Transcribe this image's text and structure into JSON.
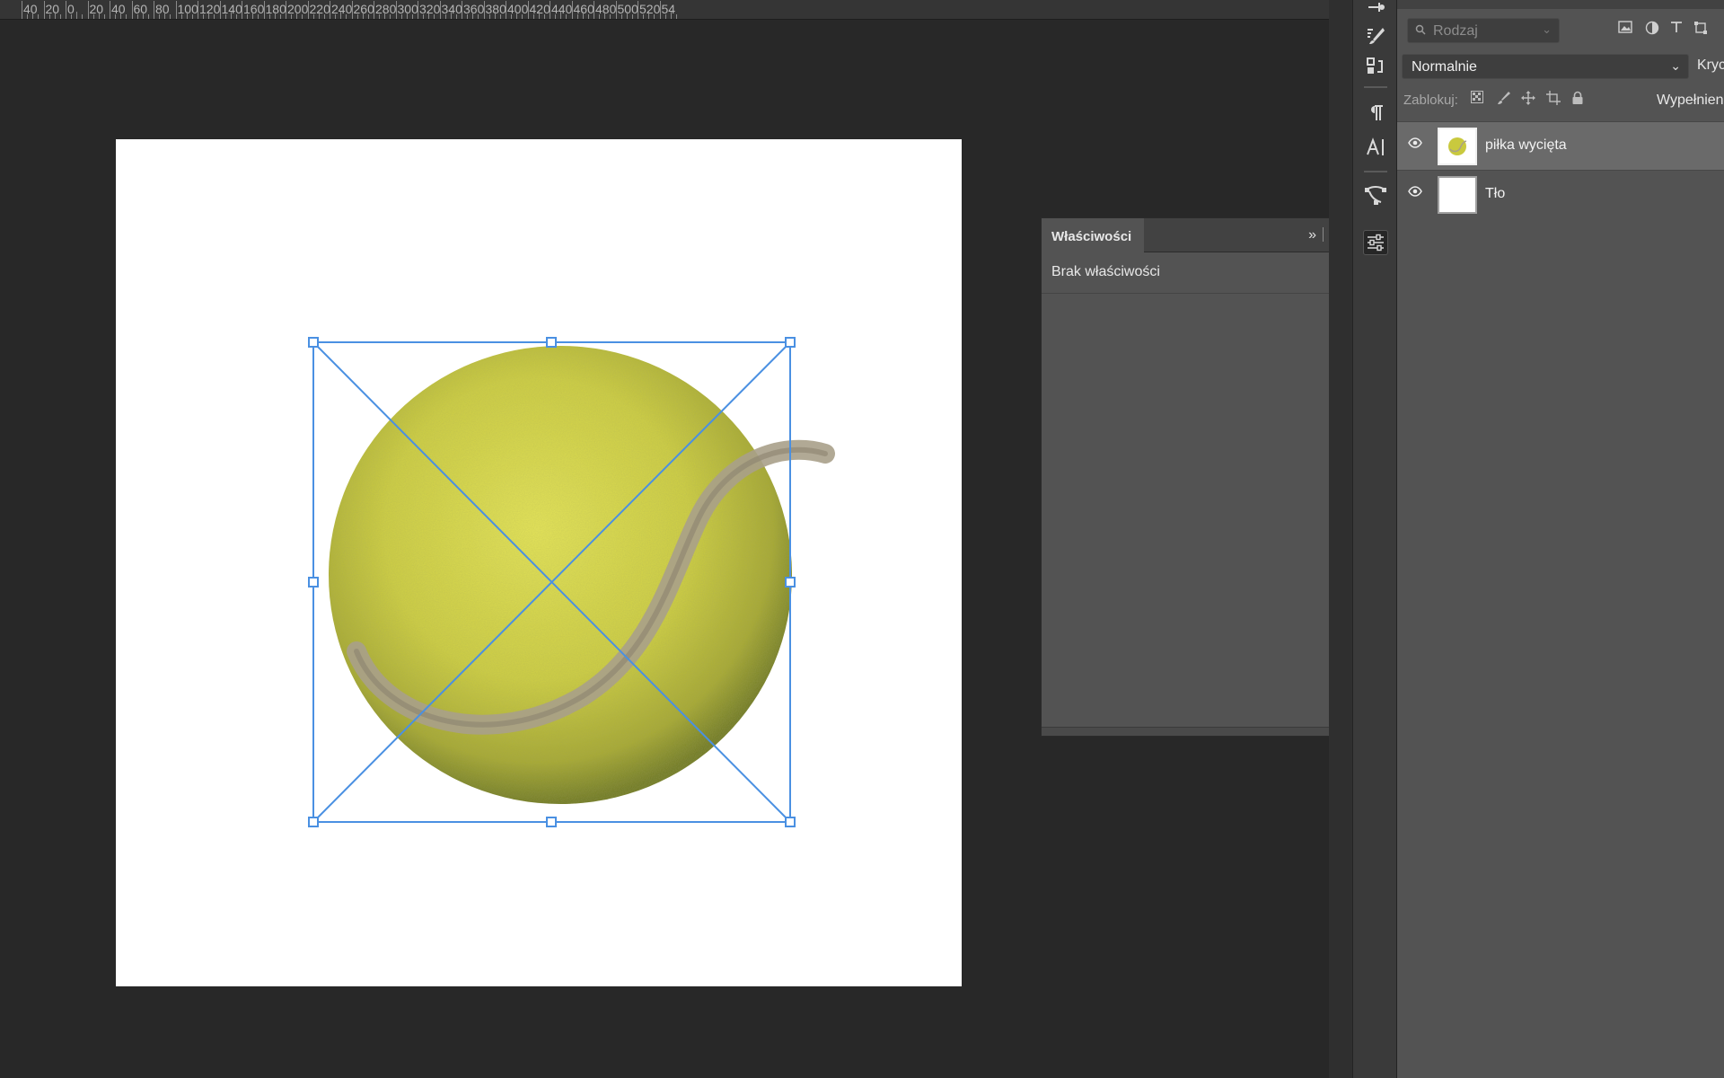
{
  "ruler": {
    "labels": [
      "40",
      "20",
      "0",
      "20",
      "40",
      "60",
      "80",
      "100",
      "120",
      "140",
      "160",
      "180",
      "200",
      "220",
      "240",
      "260",
      "280",
      "300",
      "320",
      "340",
      "360",
      "380",
      "400",
      "420",
      "440",
      "460",
      "480",
      "500",
      "520",
      "54"
    ]
  },
  "properties_panel": {
    "tab_label": "Właściwości",
    "message": "Brak właściwości"
  },
  "layers_panel": {
    "filter_placeholder": "Rodzaj",
    "blend_mode": "Normalnie",
    "opacity_label": "Kryc",
    "lock_label": "Zablokuj:",
    "fill_label": "Wypełnien",
    "layers": [
      {
        "name": "piłka wycięta",
        "visible": true,
        "selected": true
      },
      {
        "name": "Tło",
        "visible": true,
        "selected": false
      }
    ]
  },
  "icons": {
    "collapse": "»",
    "eye": "👁",
    "search": "⌕",
    "chevron": "⌄"
  }
}
